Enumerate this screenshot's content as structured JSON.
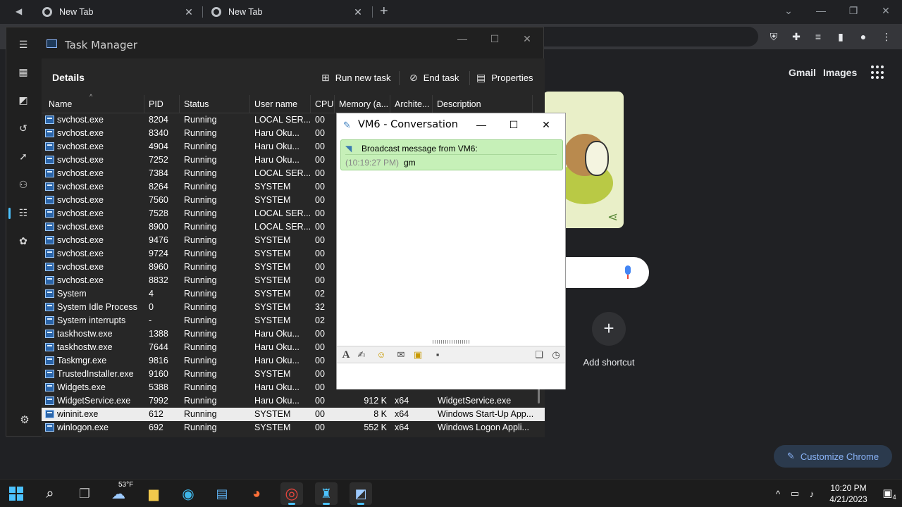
{
  "chrome": {
    "tabs": [
      {
        "title": "New Tab"
      },
      {
        "title": "New Tab"
      }
    ],
    "close_glyph": "✕",
    "new_tab_glyph": "+",
    "ntp": {
      "gmail": "Gmail",
      "images": "Images",
      "add_shortcut": "Add shortcut",
      "customize": "Customize Chrome"
    }
  },
  "taskmanager": {
    "title": "Task Manager",
    "section": "Details",
    "commands": {
      "run_new_task": "Run new task",
      "end_task": "End task",
      "properties": "Properties"
    },
    "columns": [
      "Name",
      "PID",
      "Status",
      "User name",
      "CPU",
      "Memory (a...",
      "Archite...",
      "Description"
    ],
    "rows": [
      {
        "name": "svchost.exe",
        "pid": "8204",
        "status": "Running",
        "user": "LOCAL SER...",
        "cpu": "00",
        "mem": "",
        "arch": "",
        "desc": ""
      },
      {
        "name": "svchost.exe",
        "pid": "8340",
        "status": "Running",
        "user": "Haru Oku...",
        "cpu": "00",
        "mem": "",
        "arch": "",
        "desc": ""
      },
      {
        "name": "svchost.exe",
        "pid": "4904",
        "status": "Running",
        "user": "Haru Oku...",
        "cpu": "00",
        "mem": "",
        "arch": "",
        "desc": ""
      },
      {
        "name": "svchost.exe",
        "pid": "7252",
        "status": "Running",
        "user": "Haru Oku...",
        "cpu": "00",
        "mem": "",
        "arch": "",
        "desc": ""
      },
      {
        "name": "svchost.exe",
        "pid": "7384",
        "status": "Running",
        "user": "LOCAL SER...",
        "cpu": "00",
        "mem": "",
        "arch": "",
        "desc": ""
      },
      {
        "name": "svchost.exe",
        "pid": "8264",
        "status": "Running",
        "user": "SYSTEM",
        "cpu": "00",
        "mem": "",
        "arch": "",
        "desc": ""
      },
      {
        "name": "svchost.exe",
        "pid": "7560",
        "status": "Running",
        "user": "SYSTEM",
        "cpu": "00",
        "mem": "",
        "arch": "",
        "desc": ""
      },
      {
        "name": "svchost.exe",
        "pid": "7528",
        "status": "Running",
        "user": "LOCAL SER...",
        "cpu": "00",
        "mem": "",
        "arch": "",
        "desc": ""
      },
      {
        "name": "svchost.exe",
        "pid": "8900",
        "status": "Running",
        "user": "LOCAL SER...",
        "cpu": "00",
        "mem": "",
        "arch": "",
        "desc": ""
      },
      {
        "name": "svchost.exe",
        "pid": "9476",
        "status": "Running",
        "user": "SYSTEM",
        "cpu": "00",
        "mem": "",
        "arch": "",
        "desc": ""
      },
      {
        "name": "svchost.exe",
        "pid": "9724",
        "status": "Running",
        "user": "SYSTEM",
        "cpu": "00",
        "mem": "",
        "arch": "",
        "desc": ""
      },
      {
        "name": "svchost.exe",
        "pid": "8960",
        "status": "Running",
        "user": "SYSTEM",
        "cpu": "00",
        "mem": "",
        "arch": "",
        "desc": ""
      },
      {
        "name": "svchost.exe",
        "pid": "8832",
        "status": "Running",
        "user": "SYSTEM",
        "cpu": "00",
        "mem": "",
        "arch": "",
        "desc": ""
      },
      {
        "name": "System",
        "pid": "4",
        "status": "Running",
        "user": "SYSTEM",
        "cpu": "02",
        "mem": "",
        "arch": "",
        "desc": ""
      },
      {
        "name": "System Idle Process",
        "pid": "0",
        "status": "Running",
        "user": "SYSTEM",
        "cpu": "32",
        "mem": "",
        "arch": "",
        "desc": ""
      },
      {
        "name": "System interrupts",
        "pid": "-",
        "status": "Running",
        "user": "SYSTEM",
        "cpu": "02",
        "mem": "",
        "arch": "",
        "desc": ""
      },
      {
        "name": "taskhostw.exe",
        "pid": "1388",
        "status": "Running",
        "user": "Haru Oku...",
        "cpu": "00",
        "mem": "",
        "arch": "",
        "desc": ""
      },
      {
        "name": "taskhostw.exe",
        "pid": "7644",
        "status": "Running",
        "user": "Haru Oku...",
        "cpu": "00",
        "mem": "",
        "arch": "",
        "desc": ""
      },
      {
        "name": "Taskmgr.exe",
        "pid": "9816",
        "status": "Running",
        "user": "Haru Oku...",
        "cpu": "00",
        "mem": "",
        "arch": "",
        "desc": ""
      },
      {
        "name": "TrustedInstaller.exe",
        "pid": "9160",
        "status": "Running",
        "user": "SYSTEM",
        "cpu": "00",
        "mem": "",
        "arch": "",
        "desc": ""
      },
      {
        "name": "Widgets.exe",
        "pid": "5388",
        "status": "Running",
        "user": "Haru Oku...",
        "cpu": "00",
        "mem": "",
        "arch": "",
        "desc": ""
      },
      {
        "name": "WidgetService.exe",
        "pid": "7992",
        "status": "Running",
        "user": "Haru Oku...",
        "cpu": "00",
        "mem": "912 K",
        "arch": "x64",
        "desc": "WidgetService.exe"
      },
      {
        "name": "wininit.exe",
        "pid": "612",
        "status": "Running",
        "user": "SYSTEM",
        "cpu": "00",
        "mem": "8 K",
        "arch": "x64",
        "desc": "Windows Start-Up App..."
      },
      {
        "name": "winlogon.exe",
        "pid": "692",
        "status": "Running",
        "user": "SYSTEM",
        "cpu": "00",
        "mem": "552 K",
        "arch": "x64",
        "desc": "Windows Logon Appli..."
      }
    ],
    "selected_row_index": 22
  },
  "vm6": {
    "title": "VM6 - Conversation",
    "message": {
      "header": "Broadcast message from VM6:",
      "time": "(10:19:27 PM)",
      "text": "gm"
    },
    "input_value": ""
  },
  "taskbar": {
    "weather": "53°F",
    "time": "10:20 PM",
    "date": "4/21/2023",
    "notifications": "4"
  },
  "colors": {
    "accent": "#4cc2ff",
    "message_bg": "#c6f0b8",
    "chrome_link": "#8ab4f8"
  }
}
